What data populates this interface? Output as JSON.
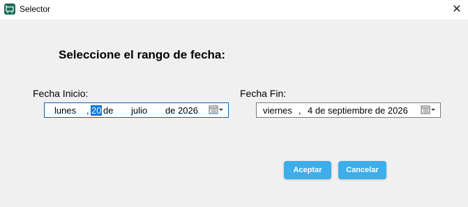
{
  "window": {
    "title": "Selector",
    "close_glyph": "✕"
  },
  "heading": "Seleccione el rango de fecha:",
  "start": {
    "label": "Fecha Inicio:",
    "weekday": "lunes",
    "sep1": ",",
    "day": "20",
    "de1": "de",
    "month": "julio",
    "year_text": "de 2026"
  },
  "end": {
    "label": "Fecha Fin:",
    "weekday": "viernes",
    "sep1": ",",
    "rest": "4 de septiembre de 2026"
  },
  "buttons": {
    "accept": "Aceptar",
    "cancel": "Cancelar"
  },
  "colors": {
    "button_bg": "#3daee9",
    "selection": "#0078d7",
    "focus_border": "#0a64ad"
  },
  "icons": {
    "app": "app-icon",
    "calendar": "calendar-dropdown-icon"
  }
}
